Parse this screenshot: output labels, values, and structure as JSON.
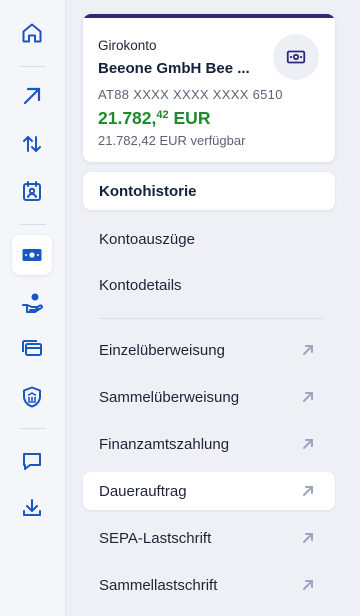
{
  "account": {
    "type": "Girokonto",
    "name": "Beeone GmbH Bee ...",
    "iban": "AT88 XXXX XXXX XXXX 6510",
    "balance_main": "21.782,",
    "balance_cents": "42",
    "balance_currency": " EUR",
    "available": "21.782,42 EUR verfügbar",
    "icon": "money-icon"
  },
  "menu": {
    "kontohistorie": "Kontohistorie",
    "kontoauszuege": "Kontoauszüge",
    "kontodetails": "Kontodetails",
    "einzelueberweisung": "Einzelüberweisung",
    "sammelueberweisung": "Sammelüberweisung",
    "finanzamtszahlung": "Finanzamtszahlung",
    "dauerauftrag": "Dauerauftrag",
    "sepa_lastschrift": "SEPA-Lastschrift",
    "sammellastschrift": "Sammellastschrift"
  },
  "rail": {
    "icons": [
      "home-icon",
      "send-arrow-icon",
      "transfer-icon",
      "calendar-person-icon",
      "money-icon",
      "hand-coin-icon",
      "cards-icon",
      "shield-bank-icon",
      "chat-icon",
      "download-icon"
    ]
  },
  "colors": {
    "accent": "#1a56c4",
    "balance_green": "#1f8a2c",
    "card_top": "#2d2b78",
    "ext_arrow": "#9aa6bf"
  }
}
